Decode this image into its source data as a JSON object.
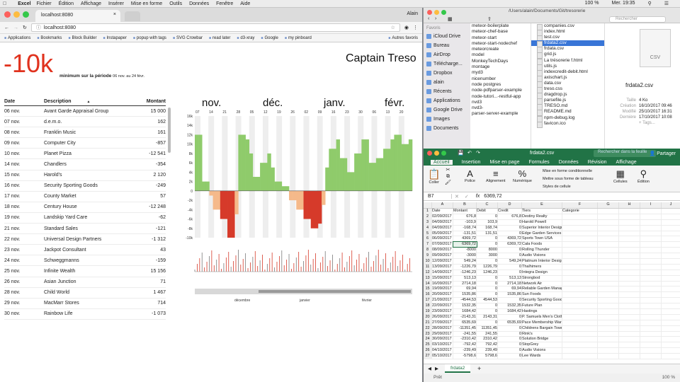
{
  "menubar": {
    "app": "Excel",
    "items": [
      "Fichier",
      "Édition",
      "Affichage",
      "Insérer",
      "Mise en forme",
      "Outils",
      "Données",
      "Fenêtre",
      "Aide"
    ],
    "clock": "Mer. 19:35",
    "battery": "100 %"
  },
  "browser": {
    "tab_title": "localhost:8080",
    "user": "Alain",
    "url": "localhost:8080",
    "bookmarks": [
      "Applications",
      "Bookmarks",
      "Block Builder",
      "Instapaper",
      "popup with tags",
      "SVG Crowbar",
      "read later",
      "d3-xray",
      "Google",
      "my pinboard",
      "Autres favoris"
    ]
  },
  "page": {
    "big_value": "-10k",
    "big_sub": "minimum sur la période",
    "range": "06 nov. au 24 févr.",
    "title": "Captain Treso",
    "table": {
      "headers": [
        "Date",
        "Description",
        "Montant"
      ],
      "rows": [
        [
          "06 nov.",
          "Avant Garde Appraisal Group",
          "15 000"
        ],
        [
          "07 nov.",
          "d.e.m.o.",
          "162"
        ],
        [
          "08 nov.",
          "Franklin Music",
          "161"
        ],
        [
          "09 nov.",
          "Computer City",
          "-857"
        ],
        [
          "10 nov.",
          "Planet Pizza",
          "-12 541"
        ],
        [
          "14 nov.",
          "Chandlers",
          "-354"
        ],
        [
          "15 nov.",
          "Harold's",
          "2 120"
        ],
        [
          "16 nov.",
          "Security Sporting Goods",
          "-249"
        ],
        [
          "17 nov.",
          "County Market",
          "57"
        ],
        [
          "18 nov.",
          "Century House",
          "-12 248"
        ],
        [
          "19 nov.",
          "Landskip Yard Care",
          "-62"
        ],
        [
          "21 nov.",
          "Standard Sales",
          "-121"
        ],
        [
          "22 nov.",
          "Universal Design Partners",
          "-1 312"
        ],
        [
          "23 nov.",
          "Jackpot Consultant",
          "43"
        ],
        [
          "24 nov.",
          "Schweggmanns",
          "-159"
        ],
        [
          "25 nov.",
          "Infinite Wealth",
          "15 156"
        ],
        [
          "26 nov.",
          "Asian Junction",
          "71"
        ],
        [
          "28 nov.",
          "Child World",
          "1 467"
        ],
        [
          "29 nov.",
          "MacMarr Stores",
          "714"
        ],
        [
          "30 nov.",
          "Rainbow Life",
          "-1 073"
        ]
      ]
    },
    "chart": {
      "months": [
        "nov.",
        "déc.",
        "janv.",
        "févr."
      ],
      "days": [
        "07",
        "14",
        "21",
        "28",
        "05",
        "12",
        "19",
        "26",
        "02",
        "09",
        "16",
        "23",
        "30",
        "06",
        "13",
        "20"
      ],
      "yticks": [
        "16k",
        "14k",
        "12k",
        "10k",
        "8k",
        "6k",
        "4k",
        "2k",
        "0",
        "-2k",
        "-4k",
        "-6k",
        "-8k",
        "-10k"
      ],
      "brush_labels": [
        "décembre",
        "janvier",
        "février"
      ],
      "colors": {
        "positive": "#8fcb6b",
        "negative_light": "#f5b98a",
        "negative_dark": "#d63a2a"
      }
    }
  },
  "finder": {
    "path": "/Users/alain/Documents/Git/tresorerie",
    "search": "Rechercher",
    "favorites_label": "Favoris",
    "sidebar": [
      "iCloud Drive",
      "Bureau",
      "AirDrop",
      "Télécharge...",
      "Dropbox",
      "alain",
      "Récents",
      "Applications",
      "Google Drive",
      "Images",
      "Documents"
    ],
    "col1": [
      "meteor-boilerplate",
      "meteor-chef-base",
      "meteor-start",
      "meteor-start-nodechef",
      "meteorcreate",
      "model",
      "MonkeyTechDays",
      "montage",
      "myd3",
      "nicenumber",
      "node postgres",
      "node-pdfparser-example",
      "node-tutori...-restful-app",
      "nvd3",
      "nvd3-",
      "parser-server-example"
    ],
    "col2": [
      "companies.csv",
      "index.html",
      "test.csv",
      "frdata2.csv",
      "frdata.csv",
      "grid.js",
      "La trésorerie f.html",
      "utils.js",
      "indexcredit-debit.html",
      "axischart.js",
      "data.csv",
      "treso.css",
      "dragdrop.js",
      "parsefile.js",
      "TRESO.md",
      "README.md",
      "npm-debug.log",
      "favicon.ico"
    ],
    "selected": "frdata2.csv",
    "preview": {
      "icon_label": "CSV",
      "name": "frdata2.csv",
      "size_k": "Taille",
      "size": "4 Ko",
      "created_k": "Création",
      "created": "16/10/2017 09:46",
      "modified_k": "Modifié",
      "modified": "25/10/2017 16:31",
      "last_k": "Dernière",
      "last": "17/10/2017 10:08",
      "tags": "+ Tags..."
    }
  },
  "excel": {
    "title": "frdata2.csv",
    "search": "Rechercher dans la feuille",
    "share": "Partager",
    "tabs": [
      "Accueil",
      "Insertion",
      "Mise en page",
      "Formules",
      "Données",
      "Révision",
      "Affichage"
    ],
    "ribbon": {
      "paste": "Coller",
      "font": "Police",
      "align": "Alignement",
      "number": "Numérique",
      "cond": "Mise en forme conditionnelle",
      "table": "Mettre sous forme de tableau",
      "styles": "Styles de cellule",
      "cells": "Cellules",
      "edit": "Édition"
    },
    "cell_ref": "B7",
    "formula": "6369,72",
    "cols": [
      "",
      "A",
      "B",
      "C",
      "D",
      "E",
      "F",
      "G",
      "H",
      "I",
      "J"
    ],
    "rows": [
      [
        "1",
        "Date",
        "Montant",
        "Debit",
        "Credit",
        "Tiers",
        "Categorie"
      ],
      [
        "2",
        "02/09/2017",
        "676,8",
        "0",
        "676,8",
        "Destiny Realty",
        ""
      ],
      [
        "3",
        "04/09/2017",
        "-103,9",
        "103,9",
        "0",
        "Harold Powell",
        ""
      ],
      [
        "4",
        "04/09/2017",
        "-168,74",
        "168,74",
        "0",
        "Superior Interior Design",
        ""
      ],
      [
        "5",
        "05/09/2017",
        "-131,51",
        "131,51",
        "0",
        "Edge Garden Services",
        ""
      ],
      [
        "6",
        "06/09/2017",
        "4369,72",
        "0",
        "4369,72",
        "Sports Town USA",
        ""
      ],
      [
        "7",
        "07/09/2017",
        "6369,72",
        "0",
        "6369,72",
        "Cala Foods",
        ""
      ],
      [
        "8",
        "08/09/2017",
        "-8000",
        "8000",
        "0",
        "Rolling Thunder",
        ""
      ],
      [
        "9",
        "09/09/2017",
        "-3000",
        "3000",
        "0",
        "Audio Visions",
        ""
      ],
      [
        "10",
        "12/09/2017",
        "549,24",
        "0",
        "549,24",
        "Platinum Interior Design",
        ""
      ],
      [
        "11",
        "13/09/2017",
        "-1226,79",
        "1226,79",
        "0",
        "Thalhimers",
        ""
      ],
      [
        "12",
        "14/09/2017",
        "-1246,23",
        "1246,23",
        "0",
        "Integra Design",
        ""
      ],
      [
        "13",
        "15/09/2017",
        "513,13",
        "0",
        "513,13",
        "Strongbod",
        ""
      ],
      [
        "14",
        "16/09/2017",
        "2714,18",
        "0",
        "2714,18",
        "Network Air",
        ""
      ],
      [
        "15",
        "19/09/2017",
        "69,94",
        "0",
        "69,94",
        "Reliable Garden Management",
        ""
      ],
      [
        "16",
        "20/09/2017",
        "1535,86",
        "0",
        "1535,86",
        "Sun Foods",
        ""
      ],
      [
        "17",
        "21/09/2017",
        "-4544,53",
        "4544,53",
        "0",
        "Security Sporting Goods",
        ""
      ],
      [
        "18",
        "22/09/2017",
        "1532,35",
        "0",
        "1532,35",
        "Future Plan",
        ""
      ],
      [
        "19",
        "23/09/2017",
        "1684,42",
        "0",
        "1684,42",
        "Hastings",
        ""
      ],
      [
        "20",
        "26/09/2017",
        "-2143,31",
        "2143,31",
        "0",
        "P. Samuels Men's Clothiers",
        ""
      ],
      [
        "21",
        "27/09/2017",
        "6535,69",
        "0",
        "6535,69",
        "Pace Membership Warehouse",
        ""
      ],
      [
        "22",
        "28/09/2017",
        "-11351,45",
        "11351,45",
        "0",
        "Childrens Bargain Town",
        ""
      ],
      [
        "23",
        "29/09/2017",
        "-241,55",
        "241,55",
        "0",
        "Rink's",
        ""
      ],
      [
        "24",
        "30/09/2017",
        "-2310,42",
        "2310,42",
        "0",
        "Solution Bridge",
        ""
      ],
      [
        "25",
        "03/10/2017",
        "-792,42",
        "792,42",
        "0",
        "StopGrey",
        ""
      ],
      [
        "26",
        "04/10/2017",
        "-239,49",
        "239,49",
        "0",
        "Audio Visions",
        ""
      ],
      [
        "27",
        "05/10/2017",
        "-5798,6",
        "5798,6",
        "0",
        "Lee Wards",
        ""
      ]
    ],
    "sheet": "frdata2",
    "status": "Prêt",
    "zoom": "100 %"
  }
}
